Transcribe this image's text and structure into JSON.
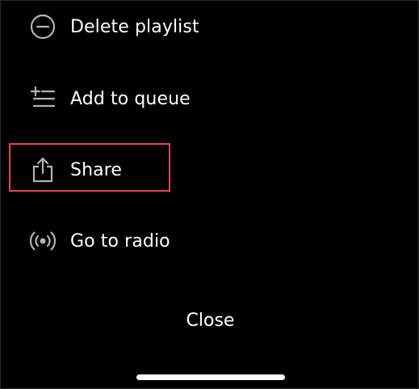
{
  "menu": {
    "items": [
      {
        "id": "delete",
        "label": "Delete playlist",
        "icon": "minus-circle-icon"
      },
      {
        "id": "queue",
        "label": "Add to queue",
        "icon": "add-to-queue-icon"
      },
      {
        "id": "share",
        "label": "Share",
        "icon": "share-icon"
      },
      {
        "id": "radio",
        "label": "Go to radio",
        "icon": "radio-icon"
      }
    ],
    "close_label": "Close"
  },
  "colors": {
    "background": "#000000",
    "text": "#ffffff",
    "icon": "#b3b3b3",
    "highlight": "#e0484f"
  }
}
